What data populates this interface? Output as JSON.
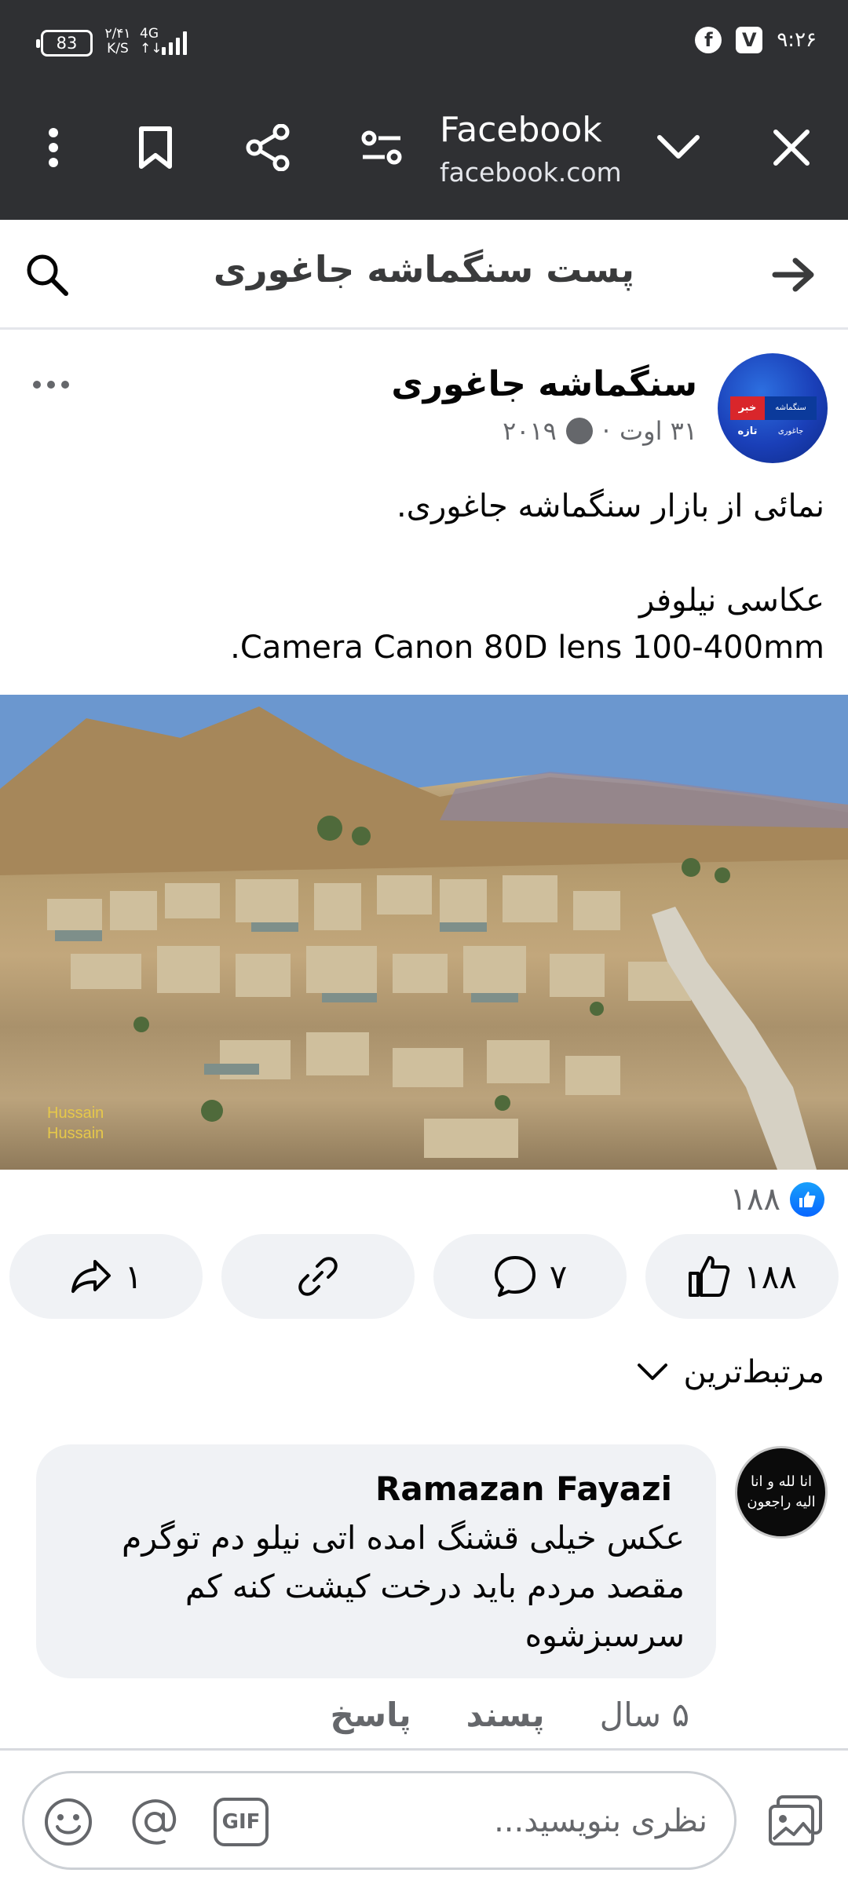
{
  "status_bar": {
    "battery": "83",
    "net_speed_top": "۲/۴۱",
    "net_speed_bottom": "K/S",
    "network_top": "4G",
    "network_bottom": "↑↓",
    "clock": "۹:۲۶",
    "notification_icons": [
      "facebook-icon",
      "v-app-icon"
    ]
  },
  "browser": {
    "title": "Facebook",
    "url": "facebook.com",
    "icons": [
      "more-vertical-icon",
      "bookmark-icon",
      "share-icon",
      "page-settings-icon",
      "chevron-down-icon",
      "close-icon"
    ]
  },
  "page_header": {
    "title": "پست سنگماشه جاغوری",
    "left_icon": "search-icon",
    "right_icon": "arrow-right-icon"
  },
  "post": {
    "author": "سنگماشه جاغوری",
    "date": "۳۱ اوت",
    "separator": "·",
    "year": "۲۰۱۹",
    "avatar_badge_red": "خبر تازه",
    "avatar_badge_blue": "سنگماشه جاغوری",
    "text_lines": [
      "نمائی از بازار سنگماشه جاغوری.",
      "",
      "عکاسی نیلوفر",
      "Camera Canon 80D lens 100-400mm."
    ],
    "photo_watermark": "Hussain Hussain",
    "reaction_count": "۱۸۸"
  },
  "actions": {
    "like": "۱۸۸",
    "comment": "۷",
    "link": "",
    "share": "۱"
  },
  "sort_label": "مرتبط‌ترین",
  "comment": {
    "author": "Ramazan Fayazi",
    "avatar_text": "انا لله و انا الیه راجعون",
    "text": "عکس خیلی قشنگ امده اتی نیلو دم توگرم مقصد مردم باید درخت کیشت کنه کم سرسبزشوه",
    "time": "۵ سال",
    "like_label": "پسند",
    "reply_label": "پاسخ"
  },
  "composer": {
    "placeholder": "نظری بنویسید...",
    "gif_label": "GIF"
  },
  "colors": {
    "chrome_bg": "#2f3033",
    "facebook_blue": "#0866ff",
    "secondary_text": "#65676b",
    "pill_bg": "#f0f2f5"
  }
}
